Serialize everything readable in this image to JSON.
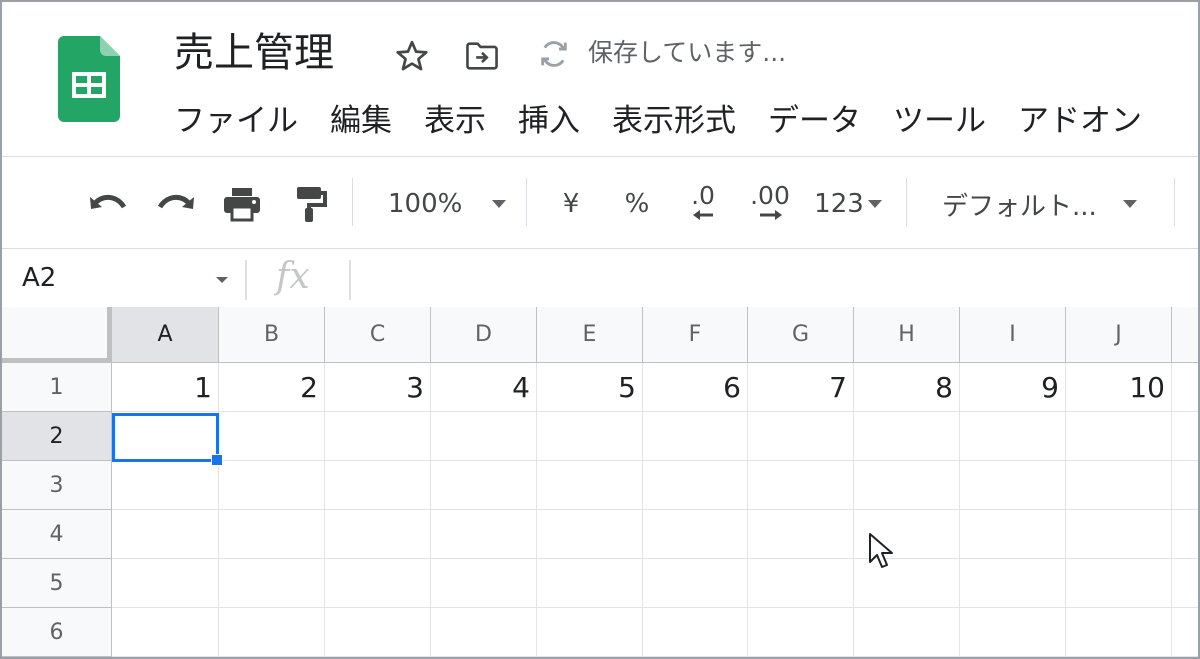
{
  "doc": {
    "title": "売上管理",
    "status": "保存しています..."
  },
  "menu": [
    "ファイル",
    "編集",
    "表示",
    "挿入",
    "表示形式",
    "データ",
    "ツール",
    "アドオン"
  ],
  "toolbar": {
    "zoom": "100%",
    "currency": "¥",
    "percent": "%",
    "decrease_decimal": ".0",
    "increase_decimal": ".00",
    "number_format": "123",
    "font": "デフォルト..."
  },
  "formula_bar": {
    "name_box": "A2",
    "fx": "fx",
    "value": ""
  },
  "grid": {
    "columns": [
      "A",
      "B",
      "C",
      "D",
      "E",
      "F",
      "G",
      "H",
      "I",
      "J"
    ],
    "rows": [
      "1",
      "2",
      "3",
      "4",
      "5",
      "6"
    ],
    "cells": [
      [
        "1",
        "2",
        "3",
        "4",
        "5",
        "6",
        "7",
        "8",
        "9",
        "10"
      ],
      [
        "",
        "",
        "",
        "",
        "",
        "",
        "",
        "",
        "",
        ""
      ],
      [
        "",
        "",
        "",
        "",
        "",
        "",
        "",
        "",
        "",
        ""
      ],
      [
        "",
        "",
        "",
        "",
        "",
        "",
        "",
        "",
        "",
        ""
      ],
      [
        "",
        "",
        "",
        "",
        "",
        "",
        "",
        "",
        "",
        ""
      ],
      [
        "",
        "",
        "",
        "",
        "",
        "",
        "",
        "",
        "",
        ""
      ]
    ],
    "selected": "A2"
  },
  "colors": {
    "logo_green": "#23a566",
    "selection_blue": "#1a73e8"
  },
  "icons": [
    "sheets-logo-icon",
    "star-icon",
    "move-to-folder-icon",
    "sync-icon",
    "undo-icon",
    "redo-icon",
    "print-icon",
    "paint-format-icon",
    "dropdown-arrow-icon",
    "mouse-cursor-icon"
  ]
}
